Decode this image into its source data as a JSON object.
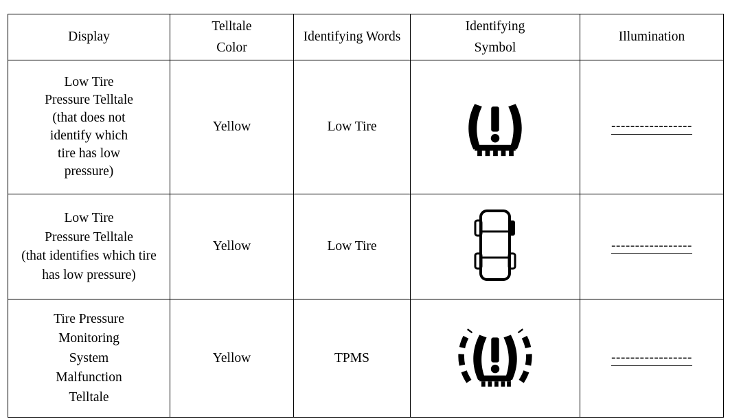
{
  "table": {
    "headers": [
      {
        "label": "Display",
        "bold": true,
        "lines": [
          "Display"
        ]
      },
      {
        "label": "Telltale Color",
        "bold": false,
        "lines": [
          "Telltale",
          "Color"
        ]
      },
      {
        "label": "Identifying Words",
        "bold": false,
        "lines": [
          "Identifying Words"
        ]
      },
      {
        "label": "Identifying Symbol",
        "bold": false,
        "lines": [
          "Identifying",
          "Symbol"
        ]
      },
      {
        "label": "Illumination",
        "bold": false,
        "lines": [
          "Illumination"
        ]
      }
    ],
    "rows": [
      {
        "display_lines": [
          "Low Tire",
          "Pressure Telltale",
          "(that does not",
          "identify which",
          "tire has low",
          "pressure)"
        ],
        "telltale_color": "Yellow",
        "identifying_words": "Low Tire",
        "identifying_symbol": "low-tire-pressure-telltale-icon",
        "illumination": "-----------------"
      },
      {
        "display_lines": [
          "Low Tire",
          "Pressure Telltale",
          "(that identifies which tire",
          "has low pressure)"
        ],
        "telltale_color": "Yellow",
        "identifying_words": "Low Tire",
        "identifying_symbol": "car-top-view-low-tire-location-icon",
        "illumination": "-----------------"
      },
      {
        "display_lines": [
          "Tire Pressure",
          "Monitoring",
          "System",
          "Malfunction",
          "Telltale"
        ],
        "telltale_color": "Yellow",
        "identifying_words": "TPMS",
        "identifying_symbol": "tpms-malfunction-telltale-icon",
        "illumination": "-----------------"
      }
    ]
  },
  "colors": {
    "border": "#000000",
    "text": "#000000",
    "background": "#ffffff",
    "symbol": "#000000"
  }
}
